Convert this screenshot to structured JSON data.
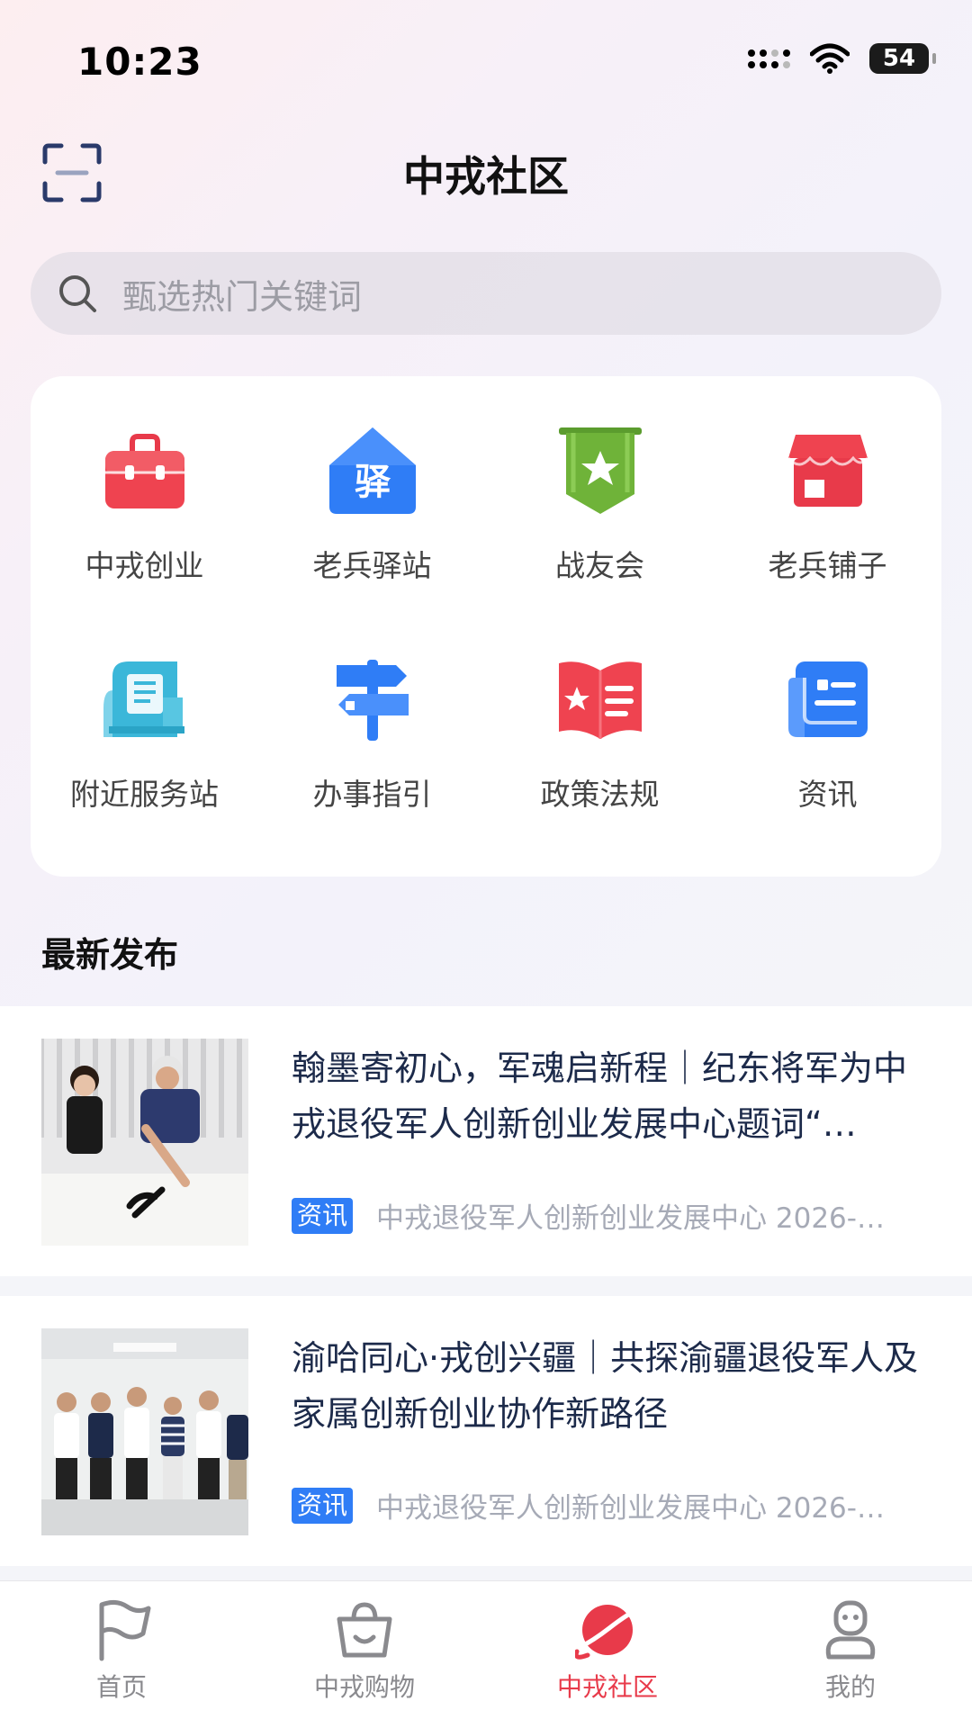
{
  "status_bar": {
    "time": "10:23",
    "battery": "54"
  },
  "header": {
    "title": "中戎社区"
  },
  "search": {
    "placeholder": "甄选热门关键词"
  },
  "grid": [
    {
      "label": "中戎创业",
      "icon": "briefcase-icon"
    },
    {
      "label": "老兵驿站",
      "icon": "house-station-icon"
    },
    {
      "label": "战友会",
      "icon": "banner-star-icon"
    },
    {
      "label": "老兵铺子",
      "icon": "shop-icon"
    },
    {
      "label": "附近服务站",
      "icon": "service-station-icon"
    },
    {
      "label": "办事指引",
      "icon": "signpost-icon"
    },
    {
      "label": "政策法规",
      "icon": "book-icon"
    },
    {
      "label": "资讯",
      "icon": "news-icon"
    }
  ],
  "section": {
    "title": "最新发布"
  },
  "news": [
    {
      "title": "翰墨寄初心，军魂启新程｜纪东将军为中戎退役军人创新创业发展中心题词“…",
      "tag": "资讯",
      "meta": "中戎退役军人创新创业发展中心 2026-…"
    },
    {
      "title": "渝哈同心·戎创兴疆｜共探渝疆退役军人及家属创新创业协作新路径",
      "tag": "资讯",
      "meta": "中戎退役军人创新创业发展中心 2026-…"
    }
  ],
  "tabbar": [
    {
      "label": "首页",
      "icon": "flag-icon",
      "active": false
    },
    {
      "label": "中戎购物",
      "icon": "shopping-basket-icon",
      "active": false
    },
    {
      "label": "中戎社区",
      "icon": "planet-icon",
      "active": true
    },
    {
      "label": "我的",
      "icon": "profile-icon",
      "active": false
    }
  ],
  "colors": {
    "accent": "#e83a4a",
    "tag": "#2f7df6"
  }
}
